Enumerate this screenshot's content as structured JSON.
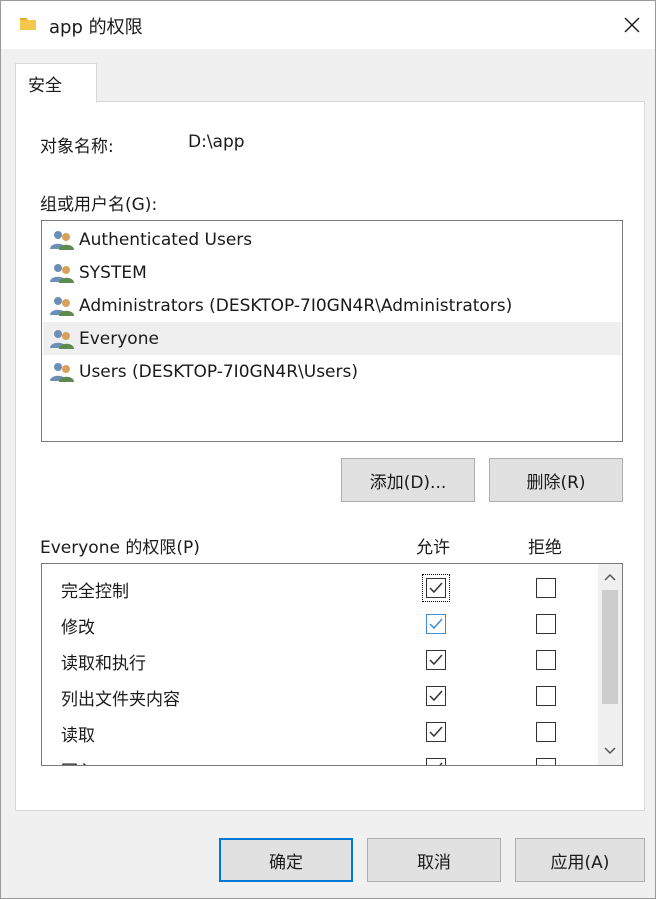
{
  "window": {
    "title": "app 的权限",
    "folder_icon": "folder-icon",
    "close_icon": "close-icon"
  },
  "tabs": [
    {
      "label": "安全",
      "active": true
    }
  ],
  "object": {
    "label": "对象名称:",
    "value": "D:\\app"
  },
  "groups": {
    "label": "组或用户名(G):",
    "items": [
      {
        "name": "Authenticated Users",
        "icon": "user-group-icon",
        "selected": false
      },
      {
        "name": "SYSTEM",
        "icon": "user-group-icon",
        "selected": false
      },
      {
        "name": "Administrators (DESKTOP-7I0GN4R\\Administrators)",
        "icon": "user-group-icon",
        "selected": false
      },
      {
        "name": "Everyone",
        "icon": "user-group-icon",
        "selected": true
      },
      {
        "name": "Users (DESKTOP-7I0GN4R\\Users)",
        "icon": "user-group-icon",
        "selected": false
      }
    ]
  },
  "buttons": {
    "add": "添加(D)...",
    "remove": "删除(R)",
    "ok": "确定",
    "cancel": "取消",
    "apply": "应用(A)"
  },
  "permissions": {
    "label": "Everyone 的权限(P)",
    "allow_header": "允许",
    "deny_header": "拒绝",
    "rows": [
      {
        "name": "完全控制",
        "allow": true,
        "deny": false
      },
      {
        "name": "修改",
        "allow": true,
        "deny": false
      },
      {
        "name": "读取和执行",
        "allow": true,
        "deny": false
      },
      {
        "name": "列出文件夹内容",
        "allow": true,
        "deny": false
      },
      {
        "name": "读取",
        "allow": true,
        "deny": false
      },
      {
        "name": "写入",
        "allow": true,
        "deny": false
      }
    ]
  },
  "colors": {
    "accent": "#0078d7",
    "checkbox_blue": "#3c8fd6"
  }
}
